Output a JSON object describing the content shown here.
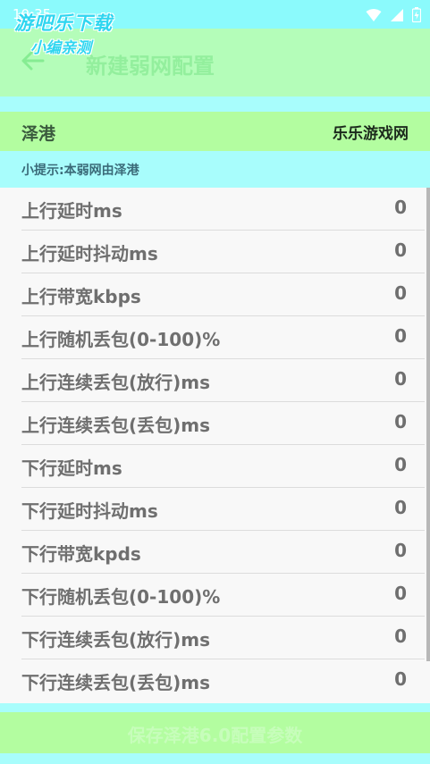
{
  "status_bar": {
    "time": "10:35",
    "icons": [
      "wifi-icon",
      "signal-icon",
      "battery-icon"
    ]
  },
  "watermark": {
    "line1": "游吧乐下载",
    "line2": "小编亲测"
  },
  "app_bar": {
    "title": "新建弱网配置",
    "back_icon": "arrow-left-icon"
  },
  "section": {
    "left": "泽港",
    "right": "乐乐游戏网"
  },
  "tip": "小提示:本弱网由泽港",
  "rows": [
    {
      "label": "上行延时ms",
      "value": "0"
    },
    {
      "label": "上行延时抖动ms",
      "value": "0"
    },
    {
      "label": "上行带宽kbps",
      "value": "0"
    },
    {
      "label": "上行随机丢包(0-100)%",
      "value": "0"
    },
    {
      "label": "上行连续丢包(放行)ms",
      "value": "0"
    },
    {
      "label": "上行连续丢包(丢包)ms",
      "value": "0"
    },
    {
      "label": "下行延时ms",
      "value": "0"
    },
    {
      "label": "下行延时抖动ms",
      "value": "0"
    },
    {
      "label": "下行带宽kpds",
      "value": "0"
    },
    {
      "label": "下行随机丢包(0-100)%",
      "value": "0"
    },
    {
      "label": "下行连续丢包(放行)ms",
      "value": "0"
    },
    {
      "label": "下行连续丢包(丢包)ms",
      "value": "0"
    }
  ],
  "bottom_button": {
    "label": "保存泽港6.0配置参数"
  },
  "colors": {
    "status_bar": "#8bfafc",
    "app_bar": "#b4fdb9",
    "section_header": "#b3fda0",
    "page_background": "#a8fdfc",
    "list_background": "#f8f8f8"
  }
}
